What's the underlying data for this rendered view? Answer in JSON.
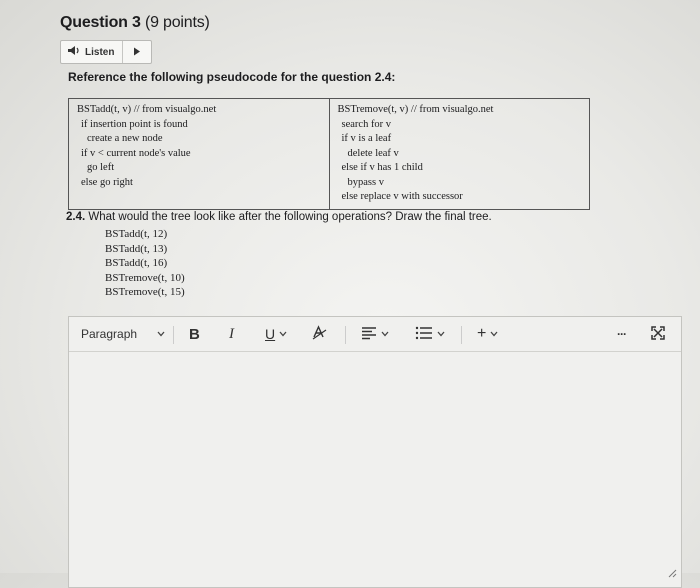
{
  "question": {
    "title": "Question 3",
    "points": "(9 points)"
  },
  "listen": {
    "label": "Listen"
  },
  "reference": {
    "text": "Reference the following pseudocode for the question 2.4:"
  },
  "pseudocode": {
    "left": [
      "BSTadd(t, v) // from visualgo.net",
      "if insertion point is found",
      "create a new node",
      "if v < current node's value",
      "go left",
      "else go right"
    ],
    "right": [
      "BSTremove(t, v) // from visualgo.net",
      "search for v",
      "if v is a leaf",
      "delete leaf v",
      "else if v has 1 child",
      "bypass v",
      "else replace v with successor"
    ]
  },
  "task": {
    "number": "2.4.",
    "text": "What would the tree look like after the following operations? Draw the final tree.",
    "operations": [
      "BSTadd(t, 12)",
      "BSTadd(t, 13)",
      "BSTadd(t, 16)",
      "BSTremove(t, 10)",
      "BSTremove(t, 15)"
    ]
  },
  "editor": {
    "paragraph_label": "Paragraph",
    "bold": "B",
    "italic": "I",
    "underline": "U",
    "plus": "+",
    "more": "···",
    "content": ""
  },
  "icons": {
    "listen": "speaker-icon",
    "play": "play-icon",
    "text-color": "text-color-icon",
    "align": "align-icon",
    "list": "list-icon",
    "insert": "plus-icon",
    "more": "more-icon",
    "fullscreen": "expand-icon",
    "resize": "resize-handle-icon"
  }
}
